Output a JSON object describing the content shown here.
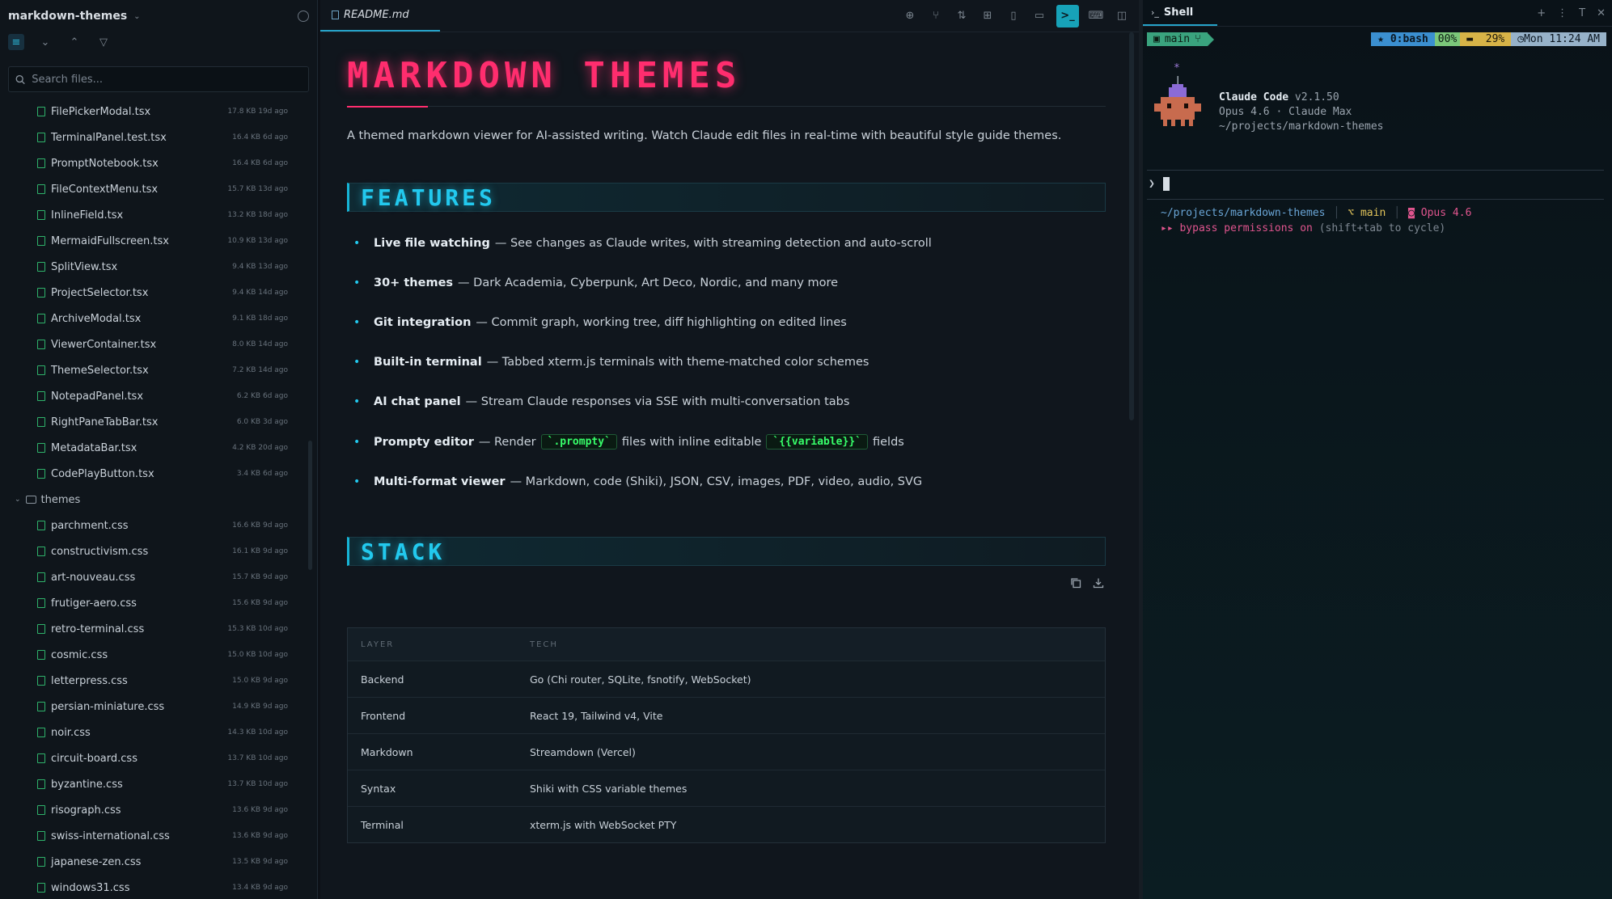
{
  "sidebar": {
    "project": "markdown-themes",
    "search_placeholder": "Search files...",
    "files_before": [
      {
        "name": "FilePickerModal.tsx",
        "meta": "17.8 KB 19d ago"
      },
      {
        "name": "TerminalPanel.test.tsx",
        "meta": "16.4 KB 6d ago"
      },
      {
        "name": "PromptNotebook.tsx",
        "meta": "16.4 KB 6d ago"
      },
      {
        "name": "FileContextMenu.tsx",
        "meta": "15.7 KB 13d ago"
      },
      {
        "name": "InlineField.tsx",
        "meta": "13.2 KB 18d ago"
      },
      {
        "name": "MermaidFullscreen.tsx",
        "meta": "10.9 KB 13d ago"
      },
      {
        "name": "SplitView.tsx",
        "meta": "9.4 KB 13d ago"
      },
      {
        "name": "ProjectSelector.tsx",
        "meta": "9.4 KB 14d ago"
      },
      {
        "name": "ArchiveModal.tsx",
        "meta": "9.1 KB 18d ago"
      },
      {
        "name": "ViewerContainer.tsx",
        "meta": "8.0 KB 14d ago"
      },
      {
        "name": "ThemeSelector.tsx",
        "meta": "7.2 KB 14d ago"
      },
      {
        "name": "NotepadPanel.tsx",
        "meta": "6.2 KB 6d ago"
      },
      {
        "name": "RightPaneTabBar.tsx",
        "meta": "6.0 KB 3d ago"
      },
      {
        "name": "MetadataBar.tsx",
        "meta": "4.2 KB 20d ago"
      },
      {
        "name": "CodePlayButton.tsx",
        "meta": "3.4 KB 6d ago"
      }
    ],
    "folder": "themes",
    "files_after": [
      {
        "name": "parchment.css",
        "meta": "16.6 KB 9d ago"
      },
      {
        "name": "constructivism.css",
        "meta": "16.1 KB 9d ago"
      },
      {
        "name": "art-nouveau.css",
        "meta": "15.7 KB 9d ago"
      },
      {
        "name": "frutiger-aero.css",
        "meta": "15.6 KB 9d ago"
      },
      {
        "name": "retro-terminal.css",
        "meta": "15.3 KB 10d ago"
      },
      {
        "name": "cosmic.css",
        "meta": "15.0 KB 10d ago"
      },
      {
        "name": "letterpress.css",
        "meta": "15.0 KB 9d ago"
      },
      {
        "name": "persian-miniature.css",
        "meta": "14.9 KB 9d ago"
      },
      {
        "name": "noir.css",
        "meta": "14.3 KB 10d ago"
      },
      {
        "name": "circuit-board.css",
        "meta": "13.7 KB 10d ago"
      },
      {
        "name": "byzantine.css",
        "meta": "13.7 KB 10d ago"
      },
      {
        "name": "risograph.css",
        "meta": "13.6 KB 9d ago"
      },
      {
        "name": "swiss-international.css",
        "meta": "13.6 KB 9d ago"
      },
      {
        "name": "japanese-zen.css",
        "meta": "13.5 KB 9d ago"
      },
      {
        "name": "windows31.css",
        "meta": "13.4 KB 9d ago"
      }
    ]
  },
  "viewer": {
    "tab_label": "README.md",
    "title": "MARKDOWN THEMES",
    "intro": "A themed markdown viewer for AI-assisted writing. Watch Claude edit files in real-time with beautiful style guide themes.",
    "features_heading": "FEATURES",
    "features": [
      {
        "name": "Live file watching",
        "text": "— See changes as Claude writes, with streaming detection and auto-scroll"
      },
      {
        "name": "30+ themes",
        "text": "— Dark Academia, Cyberpunk, Art Deco, Nordic, and many more"
      },
      {
        "name": "Git integration",
        "text": "— Commit graph, working tree, diff highlighting on edited lines"
      },
      {
        "name": "Built-in terminal",
        "text": "— Tabbed xterm.js terminals with theme-matched color schemes"
      },
      {
        "name": "AI chat panel",
        "text": "— Stream Claude responses via SSE with multi-conversation tabs"
      },
      {
        "name": "Prompty editor",
        "pre": "— Render",
        "code1": "`.prompty`",
        "mid": "files with inline editable",
        "code2": "`{{variable}}`",
        "post": "fields"
      },
      {
        "name": "Multi-format viewer",
        "text": "— Markdown, code (Shiki), JSON, CSV, images, PDF, video, audio, SVG"
      }
    ],
    "stack_heading": "STACK",
    "table_headers": [
      "LAYER",
      "TECH"
    ],
    "stack_rows": [
      [
        "Backend",
        "Go (Chi router, SQLite, fsnotify, WebSocket)"
      ],
      [
        "Frontend",
        "React 19, Tailwind v4, Vite"
      ],
      [
        "Markdown",
        "Streamdown (Vercel)"
      ],
      [
        "Syntax",
        "Shiki with CSS variable themes"
      ],
      [
        "Terminal",
        "xterm.js with WebSocket PTY"
      ]
    ]
  },
  "shell": {
    "tab_label": "Shell",
    "status": {
      "branch": "main",
      "session": "0:bash",
      "pct": "00%",
      "battery": "29%",
      "clock": "Mon 11:24 AM"
    },
    "claude_name": "Claude Code",
    "claude_version": "v2.1.50",
    "claude_model": "Opus 4.6 · Claude Max",
    "claude_path": "~/projects/markdown-themes",
    "prompt_symbol": "❯",
    "info_path": "~/projects/markdown-themes",
    "info_branch": "main",
    "info_model": "Opus 4.6",
    "perm_warn": "bypass permissions on",
    "perm_hint": "(shift+tab to cycle)"
  },
  "colors": {
    "title": "#ff2d6e",
    "heading": "#22c9ee",
    "code": "#37ff6a",
    "file_icon": "#2fb36b"
  }
}
